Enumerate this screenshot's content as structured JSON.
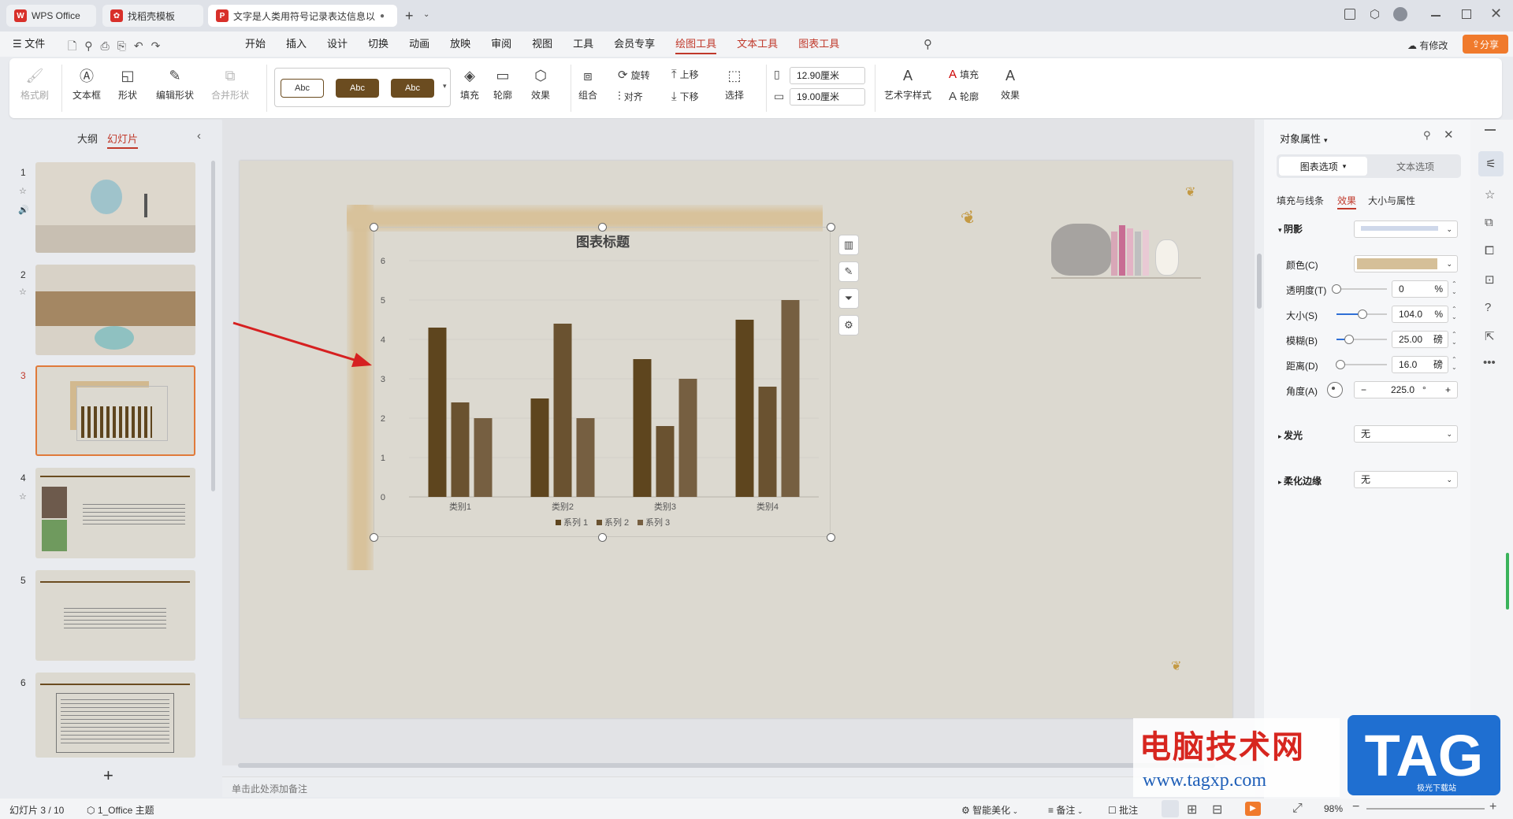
{
  "tabs": [
    {
      "label": "WPS Office"
    },
    {
      "label": "找稻壳模板"
    },
    {
      "label": "文字是人类用符号记录表达信息以"
    }
  ],
  "menubar": {
    "file": "文件",
    "items": [
      "开始",
      "插入",
      "设计",
      "切换",
      "动画",
      "放映",
      "审阅",
      "视图",
      "工具",
      "会员专享",
      "绘图工具",
      "文本工具",
      "图表工具"
    ],
    "active": "绘图工具",
    "modified": "有修改",
    "share": "分享"
  },
  "ribbon": {
    "format_painter": "格式刷",
    "textbox": "文本框",
    "shape": "形状",
    "edit_shape": "编辑形状",
    "merge_shape": "合并形状",
    "style_labels": [
      "Abc",
      "Abc",
      "Abc"
    ],
    "fill": "填充",
    "outline": "轮廓",
    "effect": "效果",
    "group": "组合",
    "rotate": "旋转",
    "align": "对齐",
    "bring_up": "上移",
    "send_down": "下移",
    "select": "选择",
    "width": "12.90厘米",
    "height": "19.00厘米",
    "art_text": "艺术字样式",
    "text_fill": "填充",
    "text_outline": "轮廓",
    "text_effect": "效果"
  },
  "left_panel": {
    "outline_tab": "大纲",
    "slides_tab": "幻灯片",
    "slide_numbers": [
      "1",
      "2",
      "3",
      "4",
      "5",
      "6"
    ],
    "add": "+"
  },
  "notes_placeholder": "单击此处添加备注",
  "chart_data": {
    "type": "bar",
    "title": "图表标题",
    "categories": [
      "类别1",
      "类别2",
      "类别3",
      "类别4"
    ],
    "series": [
      {
        "name": "系列 1",
        "values": [
          4.3,
          2.5,
          3.5,
          4.5
        ],
        "color": "#5e451e"
      },
      {
        "name": "系列 2",
        "values": [
          2.4,
          4.4,
          1.8,
          2.8
        ],
        "color": "#6a5230"
      },
      {
        "name": "系列 3",
        "values": [
          2.0,
          2.0,
          3.0,
          5.0
        ],
        "color": "#765f41"
      }
    ],
    "ylim": [
      0,
      6
    ],
    "yticks": [
      "0",
      "1",
      "2",
      "3",
      "4",
      "5",
      "6"
    ],
    "grid": true,
    "legend": "bottom"
  },
  "right_panel": {
    "title": "对象属性",
    "tab_chart": "图表选项",
    "tab_text": "文本选项",
    "sub_fill": "填充与线条",
    "sub_effect": "效果",
    "sub_size": "大小与属性",
    "shadow": "阴影",
    "color_label": "颜色(C)",
    "transparency_label": "透明度(T)",
    "transparency": "0",
    "size_label": "大小(S)",
    "size": "104.0",
    "blur_label": "模糊(B)",
    "blur": "25.00",
    "distance_label": "距离(D)",
    "distance": "16.0",
    "angle_label": "角度(A)",
    "angle": "225.0",
    "percent": "%",
    "pound": "磅",
    "degree": "°",
    "glow": "发光",
    "glow_value": "无",
    "soft_edge": "柔化边缘",
    "soft_edge_value": "无",
    "shadow_color": "#d5bf98",
    "transparency_level": 0,
    "size_level": 0.52,
    "blur_level": 0.25,
    "distance_level": 0.08
  },
  "statusbar": {
    "slide_info": "幻灯片 3 / 10",
    "theme": "1_Office 主题",
    "beautify": "智能美化",
    "notes": "备注",
    "comments": "批注",
    "zoom": "98%"
  },
  "watermark": {
    "site_name": "电脑技术网",
    "url": "www.tagxp.com",
    "tag": "TAG",
    "sub": "极光下载站"
  }
}
